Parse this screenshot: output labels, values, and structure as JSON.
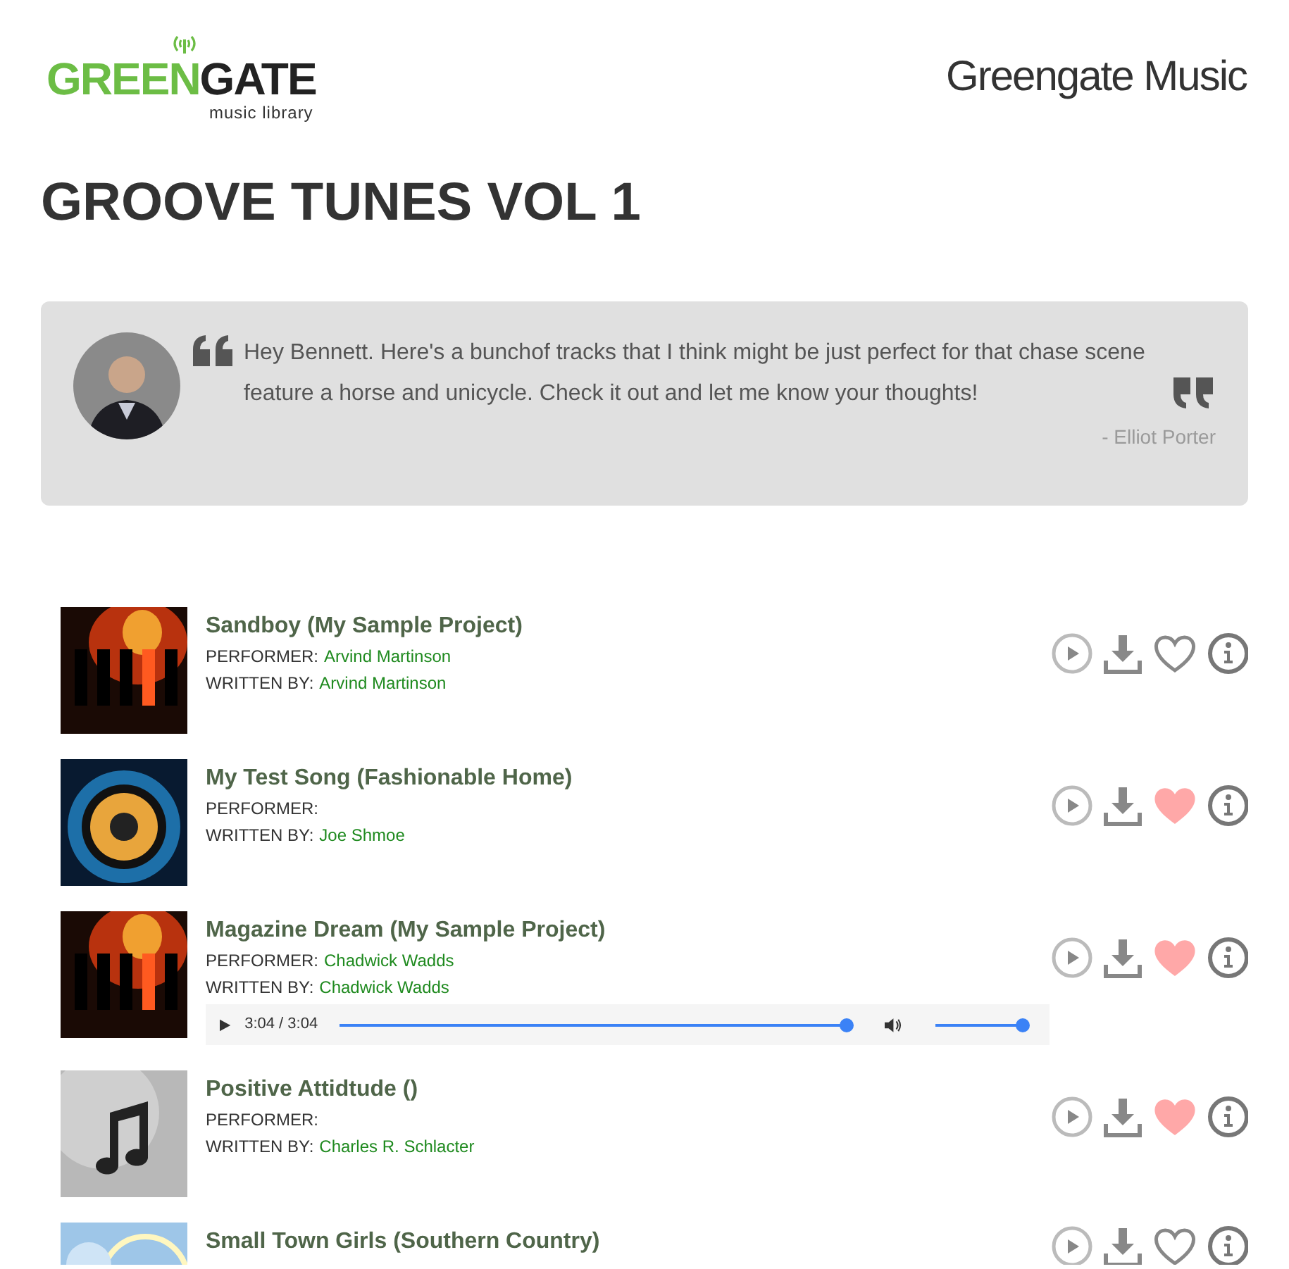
{
  "logo": {
    "part_1": "GREEN",
    "part_2": "GATE",
    "tagline": "music library"
  },
  "site_name": "Greengate Music",
  "page_title": "GROOVE TUNES VOL 1",
  "quote": {
    "text": "Hey Bennett. Here's a bunchof tracks that I think might be just perfect for that chase scene feature a horse and unicycle. Check it out and let me know your thoughts!",
    "attribution": "- Elliot Porter"
  },
  "tracks": [
    {
      "title": "Sandboy (My Sample Project)",
      "performer_label": "PERFORMER:",
      "performer": "Arvind Martinson",
      "writer_label": "WRITTEN BY:",
      "writer": "Arvind Martinson",
      "favorite": false
    },
    {
      "title": "My Test Song (Fashionable Home)",
      "performer_label": "PERFORMER:",
      "writer_label": "WRITTEN BY:",
      "writer": "Joe Shmoe",
      "favorite": true
    },
    {
      "title": "Magazine Dream (My Sample Project)",
      "performer_label": "PERFORMER:",
      "performer": "Chadwick Wadds",
      "writer_label": "WRITTEN BY:",
      "writer": "Chadwick Wadds",
      "favorite": true,
      "player": {
        "time": "3:04 / 3:04",
        "progress": {
          "level": 1
        },
        "volume": {
          "level": 1
        }
      }
    },
    {
      "title": "Positive Attidtude ()",
      "performer_label": "PERFORMER:",
      "writer_label": "WRITTEN BY:",
      "writer": "Charles R. Schlacter",
      "favorite": true
    },
    {
      "title": "Small Town Girls (Southern Country)",
      "favorite": false
    }
  ]
}
